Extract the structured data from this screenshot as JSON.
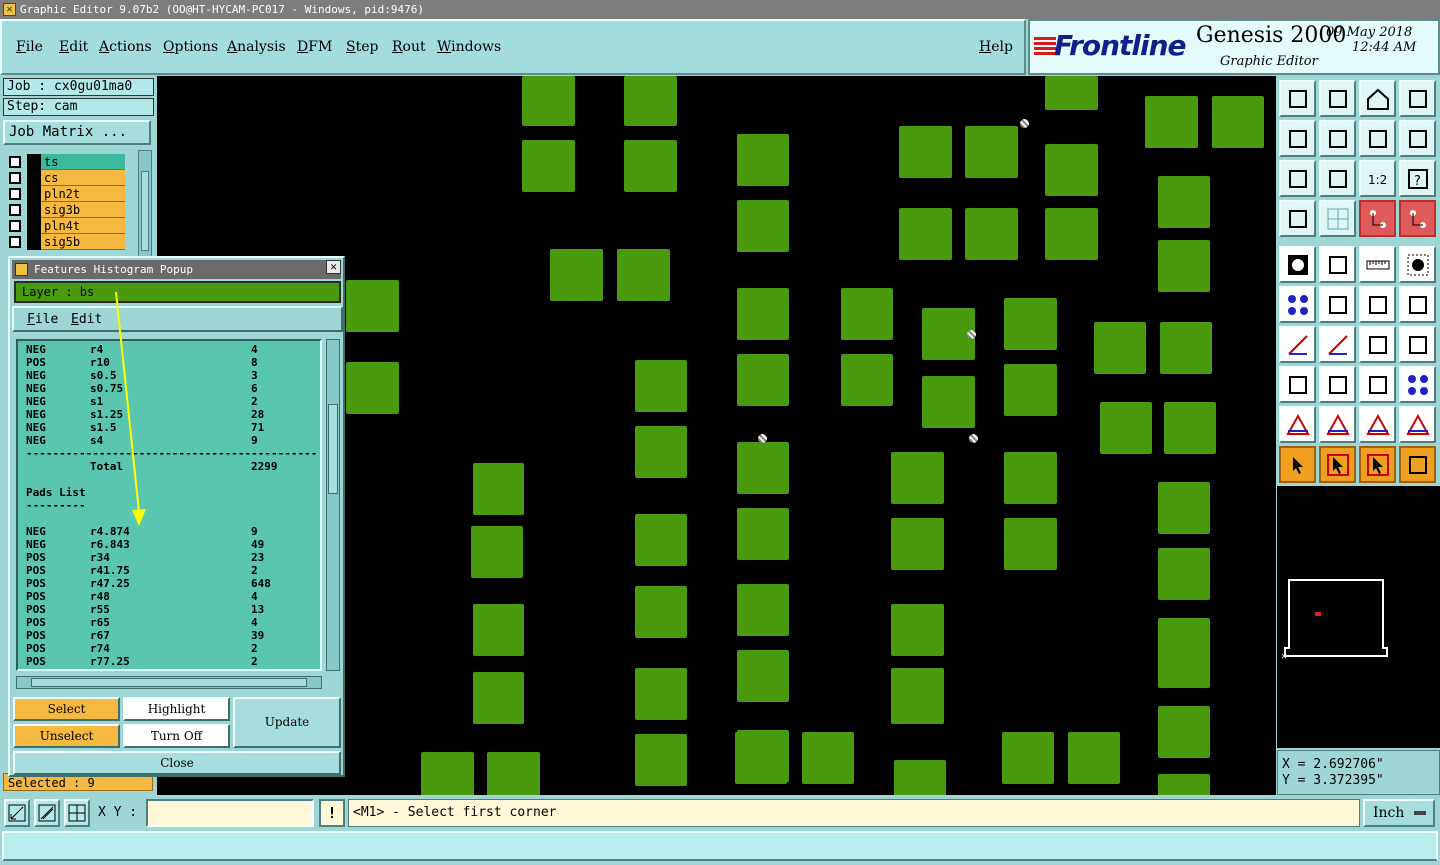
{
  "window": {
    "title": "Graphic Editor 9.07b2 (OO@HT-HYCAM-PC017 - Windows, pid:9476)"
  },
  "menu": [
    "File",
    "Edit",
    "Actions",
    "Options",
    "Analysis",
    "DFM",
    "Step",
    "Rout",
    "Windows"
  ],
  "help_label": "Help",
  "brand": {
    "logo": "Frontline",
    "product": "Genesis 2000",
    "subtitle": "Graphic Editor",
    "date": "09 May 2018",
    "time": "12:44 AM"
  },
  "job": {
    "job_label": "Job : cx0gu01ma0",
    "step_label": "Step: cam",
    "matrix_button": "Job Matrix ..."
  },
  "layers": [
    {
      "name": "ts",
      "active": true
    },
    {
      "name": "cs",
      "active": false
    },
    {
      "name": "pln2t",
      "active": false
    },
    {
      "name": "sig3b",
      "active": false
    },
    {
      "name": "pln4t",
      "active": false
    },
    {
      "name": "sig5b",
      "active": false
    }
  ],
  "selected_status": "Selected : 9",
  "popup": {
    "title": "Features Histogram Popup",
    "close_glyph": "✕",
    "layer_label": "Layer :  bs",
    "menu": [
      "File",
      "Edit"
    ],
    "rows": [
      {
        "polarity": "NEG",
        "symbol": "r4",
        "count": "4"
      },
      {
        "polarity": "POS",
        "symbol": "r10",
        "count": "8"
      },
      {
        "polarity": "NEG",
        "symbol": "s0.5",
        "count": "3"
      },
      {
        "polarity": "NEG",
        "symbol": "s0.75",
        "count": "6"
      },
      {
        "polarity": "NEG",
        "symbol": "s1",
        "count": "2"
      },
      {
        "polarity": "NEG",
        "symbol": "s1.25",
        "count": "28"
      },
      {
        "polarity": "NEG",
        "symbol": "s1.5",
        "count": "71"
      },
      {
        "polarity": "NEG",
        "symbol": "s4",
        "count": "9"
      }
    ],
    "separator": "--------------------------------------------",
    "total_label": "Total",
    "total_value": "2299",
    "pads_heading": "Pads List",
    "pads_underline": "---------",
    "pads": [
      {
        "polarity": "NEG",
        "symbol": "r4.874",
        "count": "9"
      },
      {
        "polarity": "NEG",
        "symbol": "r6.843",
        "count": "49"
      },
      {
        "polarity": "POS",
        "symbol": "r34",
        "count": "23"
      },
      {
        "polarity": "POS",
        "symbol": "r41.75",
        "count": "2"
      },
      {
        "polarity": "POS",
        "symbol": "r47.25",
        "count": "648"
      },
      {
        "polarity": "POS",
        "symbol": "r48",
        "count": "4"
      },
      {
        "polarity": "POS",
        "symbol": "r55",
        "count": "13"
      },
      {
        "polarity": "POS",
        "symbol": "r65",
        "count": "4"
      },
      {
        "polarity": "POS",
        "symbol": "r67",
        "count": "39"
      },
      {
        "polarity": "POS",
        "symbol": "r74",
        "count": "2"
      },
      {
        "polarity": "POS",
        "symbol": "r77.25",
        "count": "2"
      }
    ],
    "buttons": {
      "select": "Select",
      "highlight": "Highlight",
      "update": "Update",
      "unselect": "Unselect",
      "turn_off": "Turn Off",
      "close": "Close"
    }
  },
  "coords": {
    "x": "X = 2.692706\"",
    "y": "Y = 3.372395\""
  },
  "bottom": {
    "xy_label": "X Y :",
    "xy_value": "",
    "excl": "!",
    "prompt": "<M1> - Select first corner",
    "units": "Inch"
  },
  "tools": [
    "upload-icon",
    "download-icon",
    "home-icon",
    "window-split-icon",
    "step-left-icon",
    "step-right-icon",
    "rotate-icon",
    "s-curve-icon",
    "fit-icon",
    "zoom-center-icon",
    "ratio-icon",
    "help-icon",
    "ruler-pencil-icon",
    "grid-icon",
    "layers-red-icon",
    "layers-red-2-icon",
    "pad-icon",
    "polygon-icon",
    "ruler-icon",
    "dashed-circle-icon",
    "nodes-icon",
    "cross-node-icon",
    "line-node-icon",
    "line-node-2-icon",
    "angle-icon",
    "slash-icon",
    "arc-icon",
    "bracket-icon",
    "node-square-icon",
    "minus-line-icon",
    "dimension-icon",
    "cluster-icon",
    "triangle-icon",
    "a-shape-icon",
    "arch-icon",
    "arch-2-icon",
    "pointer-icon",
    "pointer-box-icon",
    "pointer-box-2-icon",
    "route-icon"
  ],
  "colors": {
    "pad_green": "#4a9a10",
    "canvas_bg": "#000000",
    "panel_teal": "#9ed6d6",
    "layer_orange": "#f5b840",
    "annotation_yellow": "#ffff00"
  }
}
